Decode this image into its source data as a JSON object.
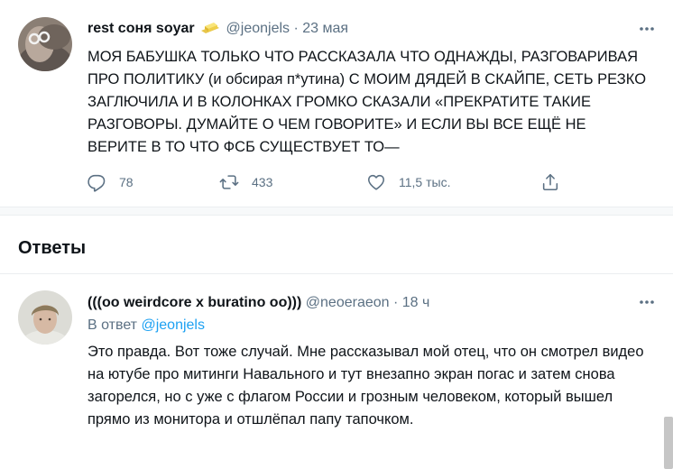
{
  "main_tweet": {
    "display_name": "rest соня soyar",
    "emoji": "butter-emoji",
    "handle": "@jeonjels",
    "separator": "·",
    "time": "23 мая",
    "text": "МОЯ БАБУШКА ТОЛЬКО ЧТО РАССКАЗАЛА ЧТО ОДНАЖДЫ, РАЗГОВАРИВАЯ ПРО ПОЛИТИКУ (и обсирая п*утина) С МОИМ ДЯДЕЙ В СКАЙПЕ, СЕТЬ РЕЗКО ЗАГЛЮЧИЛА И В КОЛОНКАХ ГРОМКО СКАЗАЛИ «ПРЕКРАТИТЕ ТАКИЕ РАЗГОВОРЫ. ДУМАЙТЕ О ЧЕМ ГОВОРИТЕ» И ЕСЛИ ВЫ ВСЕ ЕЩЁ НЕ ВЕРИТЕ В ТО ЧТО ФСБ СУЩЕСТВУЕТ ТО—",
    "actions": {
      "replies": "78",
      "retweets": "433",
      "likes": "11,5 тыс."
    }
  },
  "replies_section": {
    "title": "Ответы"
  },
  "reply_tweet": {
    "display_name": "(((oo weirdcore x buratino oo)))",
    "handle": "@neoeraeon",
    "separator": "·",
    "time": "18 ч",
    "reply_to_label": "В ответ",
    "reply_to_handle": "@jeonjels",
    "text": "Это правда. Вот тоже случай. Мне рассказывал мой отец, что он смотрел видео на ютубе про митинги Навального и тут внезапно экран погас и затем снова загорелся, но с уже с флагом России и грозным человеком, который вышел прямо из монитора и отшлёпал папу тапочком."
  },
  "colors": {
    "accent": "#1da1f2",
    "secondary_text": "#5b7083",
    "primary_text": "#0f1419",
    "divider": "#ebeef0"
  }
}
